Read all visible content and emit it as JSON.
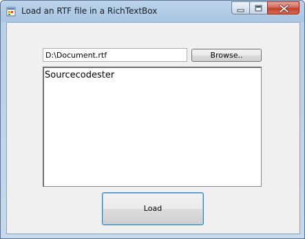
{
  "window": {
    "title": "Load an RTF file in a RichTextBox"
  },
  "form": {
    "file_path": "D:\\Document.rtf",
    "browse_label": "Browse..",
    "rich_text_content": "Sourcecodester",
    "load_label": "Load"
  },
  "icons": {
    "app": "application-window-icon",
    "minimize": "minimize-icon",
    "maximize": "maximize-icon",
    "close": "close-icon"
  }
}
